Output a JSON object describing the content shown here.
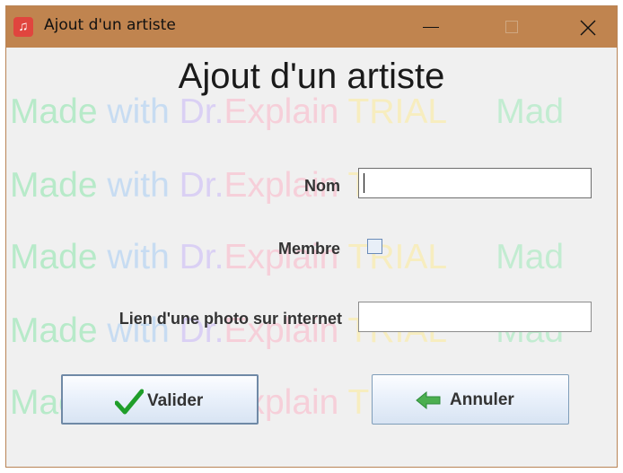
{
  "window": {
    "title": "Ajout d'un artiste",
    "icon": "music-note-icon",
    "controls": [
      "minimize-icon",
      "maximize-icon",
      "close-icon"
    ]
  },
  "form": {
    "heading": "Ajout d'un artiste",
    "nom_label": "Nom",
    "nom_value": "",
    "membre_label": "Membre",
    "membre_checked": false,
    "photo_label": "Lien d'une photo sur internet",
    "photo_value": ""
  },
  "buttons": {
    "valider_label": "Valider",
    "valider_icon": "checkmark-icon",
    "annuler_label": "Annuler",
    "annuler_icon": "arrow-left-icon"
  },
  "watermark": {
    "made": "Made",
    "with": "with",
    "dr": "Dr.",
    "explain": "Explain",
    "trial": "TRIAL",
    "tail": "Mad"
  },
  "colors": {
    "titlebar": "#c0844f",
    "checkmark": "#1f9e2a",
    "arrow": "#4caf50"
  }
}
